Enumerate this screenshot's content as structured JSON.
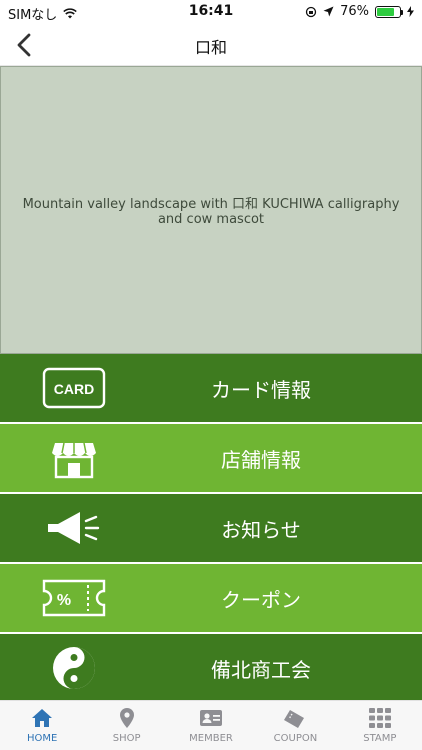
{
  "status_bar": {
    "carrier": "SIMなし",
    "time": "16:41",
    "battery_percent": "76%",
    "battery_level": 0.76
  },
  "nav": {
    "title": "口和"
  },
  "hero": {
    "image_label": "Mountain valley landscape with 口和 KUCHIWA calligraphy and cow mascot",
    "kanji_top": "口",
    "kanji_bottom": "和",
    "romaji": "KUCHIWA"
  },
  "menu": {
    "items": [
      {
        "label": "カード情報",
        "icon": "card-icon",
        "icon_text": "CARD"
      },
      {
        "label": "店舗情報",
        "icon": "shop-icon"
      },
      {
        "label": "お知らせ",
        "icon": "megaphone-icon"
      },
      {
        "label": "クーポン",
        "icon": "coupon-icon",
        "icon_text": "%"
      },
      {
        "label": "備北商工会",
        "icon": "yin-yang-icon"
      }
    ]
  },
  "tabs": [
    {
      "label": "HOME",
      "icon": "home-icon",
      "active": true
    },
    {
      "label": "SHOP",
      "icon": "location-pin-icon",
      "active": false
    },
    {
      "label": "MEMBER",
      "icon": "member-card-icon",
      "active": false
    },
    {
      "label": "COUPON",
      "icon": "coupon-ticket-icon",
      "active": false
    },
    {
      "label": "STAMP",
      "icon": "stamp-grid-icon",
      "active": false
    }
  ],
  "colors": {
    "menu_dark": "#3e7b1f",
    "menu_light": "#6fb533",
    "tab_active": "#2f74b5",
    "tab_inactive": "#8e8e93"
  }
}
